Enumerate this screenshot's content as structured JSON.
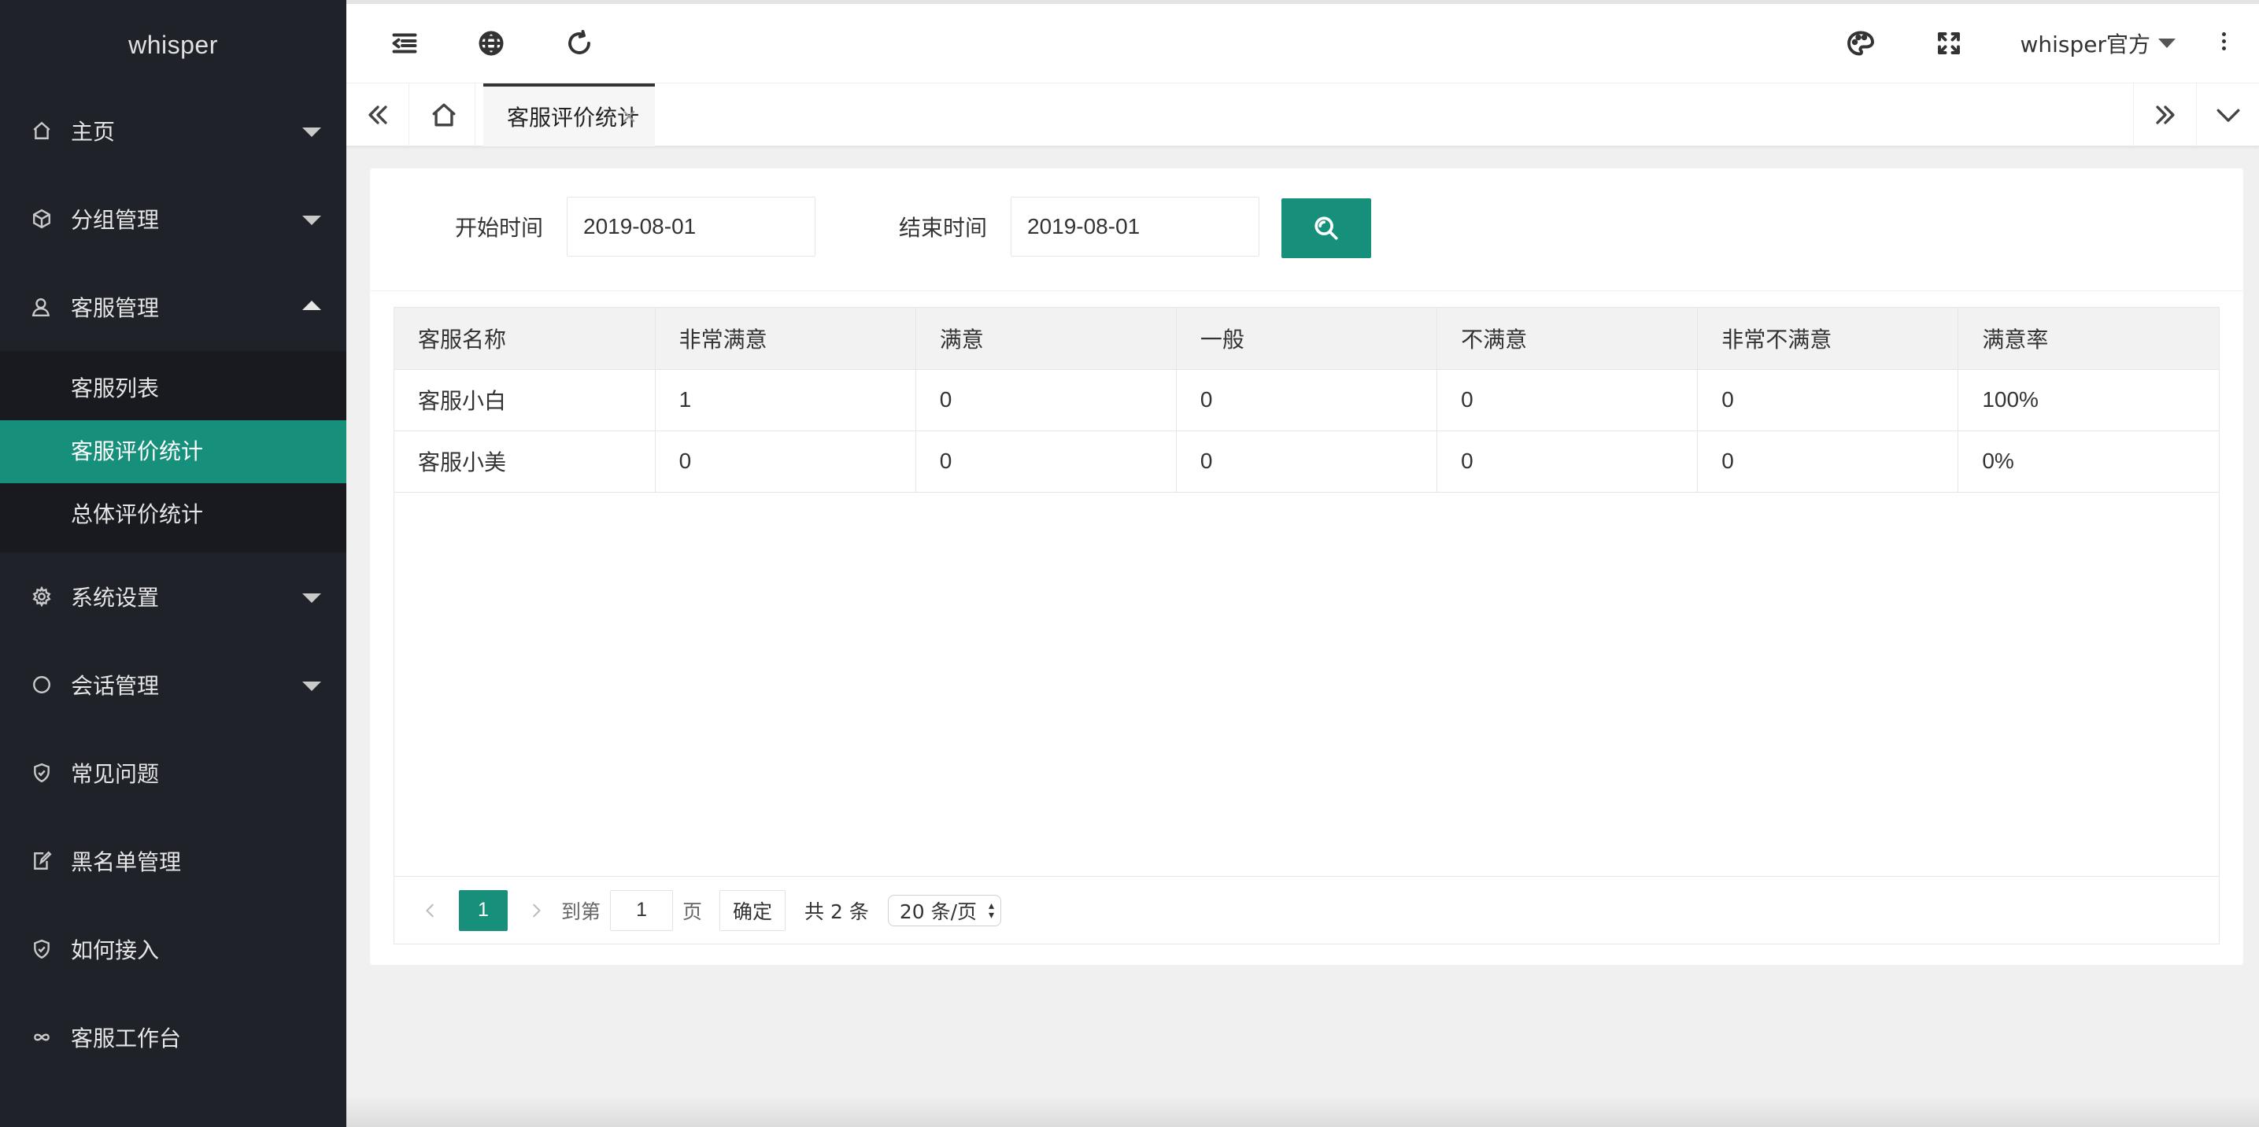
{
  "app": {
    "logo": "whisper"
  },
  "sidebar": {
    "items": [
      {
        "label": "主页",
        "icon": "home-icon"
      },
      {
        "label": "分组管理",
        "icon": "cube-icon"
      },
      {
        "label": "客服管理",
        "icon": "user-icon",
        "expanded": true
      },
      {
        "label": "系统设置",
        "icon": "gear-icon"
      },
      {
        "label": "会话管理",
        "icon": "circle-icon"
      },
      {
        "label": "常见问题",
        "icon": "shield-icon"
      },
      {
        "label": "黑名单管理",
        "icon": "edit-icon"
      },
      {
        "label": "如何接入",
        "icon": "shield-check-icon"
      },
      {
        "label": "客服工作台",
        "icon": "infinity-icon"
      }
    ],
    "sub_items": [
      {
        "label": "客服列表"
      },
      {
        "label": "客服评价统计",
        "active": true
      },
      {
        "label": "总体评价统计"
      }
    ]
  },
  "topbar": {
    "user_label": "whisper官方"
  },
  "tabs": {
    "active_label": "客服评价统计",
    "close_glyph": "×"
  },
  "filter": {
    "start_label": "开始时间",
    "start_value": "2019-08-01",
    "end_label": "结束时间",
    "end_value": "2019-08-01"
  },
  "table": {
    "columns": [
      "客服名称",
      "非常满意",
      "满意",
      "一般",
      "不满意",
      "非常不满意",
      "满意率"
    ],
    "rows": [
      [
        "客服小白",
        "1",
        "0",
        "0",
        "0",
        "0",
        "100%"
      ],
      [
        "客服小美",
        "0",
        "0",
        "0",
        "0",
        "0",
        "0%"
      ]
    ]
  },
  "pager": {
    "current_page": "1",
    "goto_label": "到第",
    "goto_value": "1",
    "page_suffix": "页",
    "confirm_label": "确定",
    "total_label": "共 2 条",
    "page_size_label": "20 条/页"
  },
  "colors": {
    "accent": "#16907a",
    "sidebar_bg": "#20222a"
  }
}
